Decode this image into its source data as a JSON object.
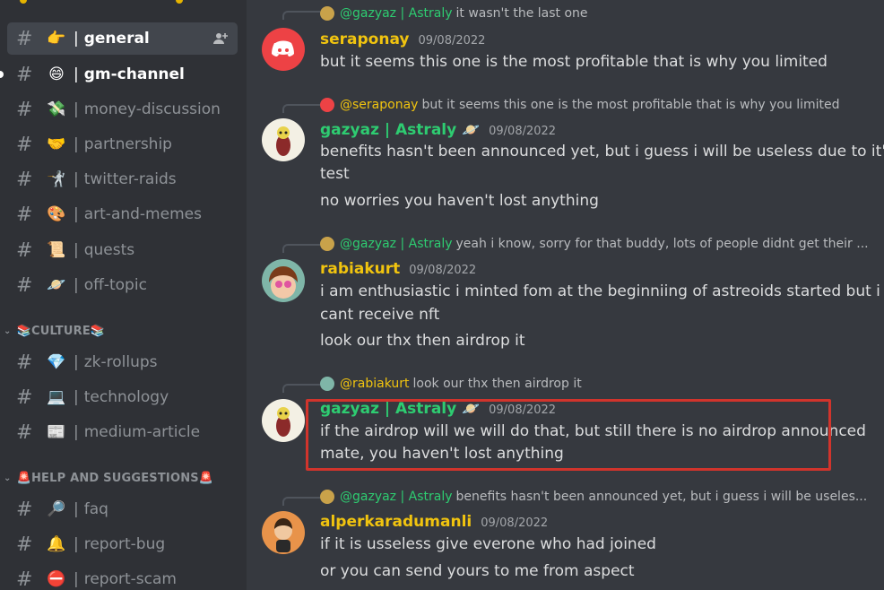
{
  "colors": {
    "sidebar_bg": "#2f3136",
    "chat_bg": "#36393f",
    "active_channel_bg": "#42464d",
    "highlight": "#d1342c",
    "name_yellow": "#f1c40f",
    "name_green": "#2ecc71"
  },
  "sidebar": {
    "channels": [
      {
        "hash": "#",
        "emoji": "👉",
        "sep": "|",
        "name": "general",
        "state": "active"
      },
      {
        "hash": "#",
        "emoji": "😄",
        "sep": "|",
        "name": "gm-channel",
        "state": "unread"
      },
      {
        "hash": "#",
        "emoji": "💸",
        "sep": "|",
        "name": "money-discussion",
        "state": "normal"
      },
      {
        "hash": "#",
        "emoji": "🤝",
        "sep": "|",
        "name": "partnership",
        "state": "normal"
      },
      {
        "hash": "#",
        "emoji": "🤺",
        "sep": "|",
        "name": "twitter-raids",
        "state": "normal"
      },
      {
        "hash": "#",
        "emoji": "🎨",
        "sep": "|",
        "name": "art-and-memes",
        "state": "normal"
      },
      {
        "hash": "#",
        "emoji": "📜",
        "sep": "|",
        "name": "quests",
        "state": "normal"
      },
      {
        "hash": "#",
        "emoji": "🪐",
        "sep": "|",
        "name": "off-topic",
        "state": "normal"
      },
      {
        "hash": "#",
        "emoji": "💎",
        "sep": "|",
        "name": "zk-rollups",
        "state": "normal"
      },
      {
        "hash": "#",
        "emoji": "💻",
        "sep": "|",
        "name": "technology",
        "state": "normal"
      },
      {
        "hash": "#",
        "emoji": "📰",
        "sep": "|",
        "name": "medium-article",
        "state": "normal"
      },
      {
        "hash": "#",
        "emoji": "🔎",
        "sep": "|",
        "name": "faq",
        "state": "normal"
      },
      {
        "hash": "#",
        "emoji": "🔔",
        "sep": "|",
        "name": "report-bug",
        "state": "normal"
      },
      {
        "hash": "#",
        "emoji": "⛔",
        "sep": "|",
        "name": "report-scam",
        "state": "normal"
      }
    ],
    "categories": [
      {
        "chevron": "⌄",
        "label": "📚CULTURE📚"
      },
      {
        "chevron": "⌄",
        "label": "🚨HELP AND SUGGESTIONS🚨"
      }
    ],
    "add_member_icon": "add-member-icon"
  },
  "chat": {
    "top_reply": {
      "name": "@gazyaz | Astraly",
      "text": "it wasn't the last one"
    },
    "messages": [
      {
        "author": "seraponay",
        "color": "#f1c40f",
        "date": "09/08/2022",
        "planet": "",
        "lines": [
          "but it seems this one is the most profitable that is why you limited"
        ]
      },
      {
        "reply": {
          "name": "@seraponay",
          "text": "but it seems this one is the most profitable that is why you limited"
        },
        "author": "gazyaz | Astraly",
        "color": "#2ecc71",
        "date": "09/08/2022",
        "planet": "🪐",
        "lines": [
          "benefits hasn't been announced yet, but i guess i will be useless due to it's",
          "test",
          "no worries you haven't lost anything"
        ]
      },
      {
        "reply": {
          "name": "@gazyaz | Astraly",
          "text": "yeah i know, sorry for that buddy, lots of people didnt get their ..."
        },
        "author": "rabiakurt",
        "color": "#f1c40f",
        "date": "09/08/2022",
        "planet": "",
        "lines": [
          "i am enthusiastic i minted fom at the beginniing of astreoids started but i",
          "cant receive nft",
          "look our thx then airdrop it"
        ]
      },
      {
        "reply": {
          "name": "@rabiakurt",
          "text": "look our thx then airdrop it"
        },
        "author": "gazyaz | Astraly",
        "color": "#2ecc71",
        "date": "09/08/2022",
        "planet": "🪐",
        "lines": [
          "if the airdrop will we will do that, but still there is no airdrop announced",
          "mate, you haven't lost anything"
        ]
      },
      {
        "reply": {
          "name": "@gazyaz | Astraly",
          "text": "benefits hasn't been announced yet, but i guess i will be useles..."
        },
        "author": "alperkaradumanli",
        "color": "#f1c40f",
        "date": "09/08/2022",
        "planet": "",
        "lines": [
          "if it is usseless give everone who had joined",
          "or you can send yours to me from aspect"
        ]
      }
    ]
  }
}
